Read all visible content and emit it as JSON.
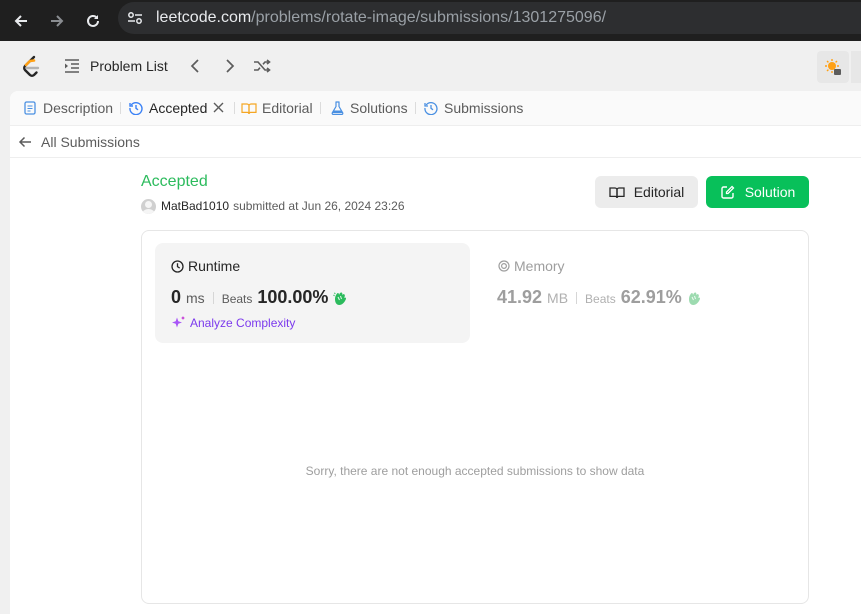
{
  "browser": {
    "url_host": "leetcode.com",
    "url_path": "/problems/rotate-image/submissions/1301275096/"
  },
  "appbar": {
    "problem_list_label": "Problem List"
  },
  "tabs": [
    {
      "label": "Description",
      "icon": "description-icon"
    },
    {
      "label": "Accepted",
      "icon": "history-icon",
      "active": true
    },
    {
      "label": "Editorial",
      "icon": "book-icon"
    },
    {
      "label": "Solutions",
      "icon": "flask-icon"
    },
    {
      "label": "Submissions",
      "icon": "history-icon"
    }
  ],
  "back": {
    "label": "All Submissions"
  },
  "submission": {
    "status": "Accepted",
    "status_color": "#2cbb5d",
    "username": "MatBad1010",
    "submitted_text": "submitted at Jun 26, 2024 23:26"
  },
  "actions": {
    "editorial_label": "Editorial",
    "solution_label": "Solution",
    "solution_color": "#08c05a"
  },
  "runtime": {
    "title": "Runtime",
    "value": "0",
    "unit": "ms",
    "beats_label": "Beats",
    "beats_pct": "100.00%",
    "analyze_label": "Analyze Complexity"
  },
  "memory": {
    "title": "Memory",
    "value": "41.92",
    "unit": "MB",
    "beats_label": "Beats",
    "beats_pct": "62.91%"
  },
  "empty_message": "Sorry, there are not enough accepted submissions to show data"
}
